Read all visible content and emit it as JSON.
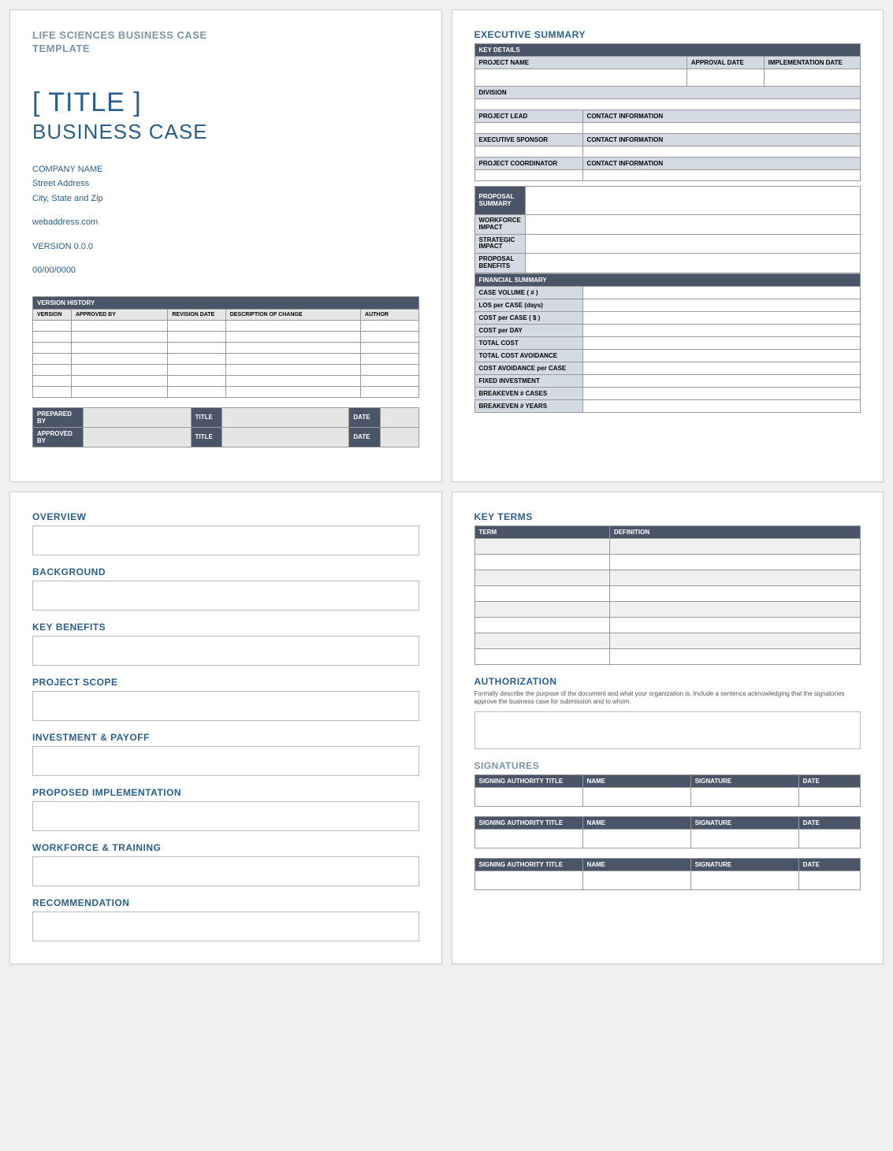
{
  "page1": {
    "docHeader1": "LIFE SCIENCES BUSINESS CASE",
    "docHeader2": "TEMPLATE",
    "title": "[ TITLE ]",
    "subtitle": "BUSINESS CASE",
    "company": "COMPANY NAME",
    "street": "Street Address",
    "cityState": "City, State and Zip",
    "web": "webaddress.com",
    "version": "VERSION 0.0.0",
    "date": "00/00/0000",
    "versionHistory": {
      "header": "VERSION HISTORY",
      "cols": [
        "VERSION",
        "APPROVED BY",
        "REVISION DATE",
        "DESCRIPTION OF CHANGE",
        "AUTHOR"
      ]
    },
    "prep": {
      "r1": [
        "PREPARED BY",
        "TITLE",
        "DATE"
      ],
      "r2": [
        "APPROVED BY",
        "TITLE",
        "DATE"
      ]
    }
  },
  "page2": {
    "header": "EXECUTIVE SUMMARY",
    "keyDetails": "KEY DETAILS",
    "projectName": "PROJECT NAME",
    "approvalDate": "APPROVAL DATE",
    "implDate": "IMPLEMENTATION DATE",
    "division": "DIVISION",
    "projectLead": "PROJECT LEAD",
    "contactInfo": "CONTACT INFORMATION",
    "execSponsor": "EXECUTIVE SPONSOR",
    "projCoord": "PROJECT COORDINATOR",
    "proposalSummary": "PROPOSAL SUMMARY",
    "workforceImpact": "WORKFORCE IMPACT",
    "strategicImpact": "STRATEGIC IMPACT",
    "proposalBenefits": "PROPOSAL BENEFITS",
    "financialSummary": "FINANCIAL SUMMARY",
    "finRows": [
      "CASE VOLUME ( # )",
      "LOS per CASE (days)",
      "COST per CASE ( $ )",
      "COST per DAY",
      "TOTAL COST",
      "TOTAL COST AVOIDANCE",
      "COST AVOIDANCE per CASE",
      "FIXED INVESTMENT",
      "BREAKEVEN # CASES",
      "BREAKEVEN # YEARS"
    ]
  },
  "page3": {
    "sections": [
      "OVERVIEW",
      "BACKGROUND",
      "KEY BENEFITS",
      "PROJECT SCOPE",
      "INVESTMENT & PAYOFF",
      "PROPOSED IMPLEMENTATION",
      "WORKFORCE & TRAINING",
      "RECOMMENDATION"
    ]
  },
  "page4": {
    "keyTerms": "KEY TERMS",
    "term": "TERM",
    "definition": "DEFINITION",
    "authorization": "AUTHORIZATION",
    "authNote": "Formally describe the purpose of the document and what your organization is. Include a sentence acknowledging that the signatories approve the business case for submission and to whom.",
    "signatures": "SIGNATURES",
    "sigCols": [
      "SIGNING AUTHORITY TITLE",
      "NAME",
      "SIGNATURE",
      "DATE"
    ]
  }
}
